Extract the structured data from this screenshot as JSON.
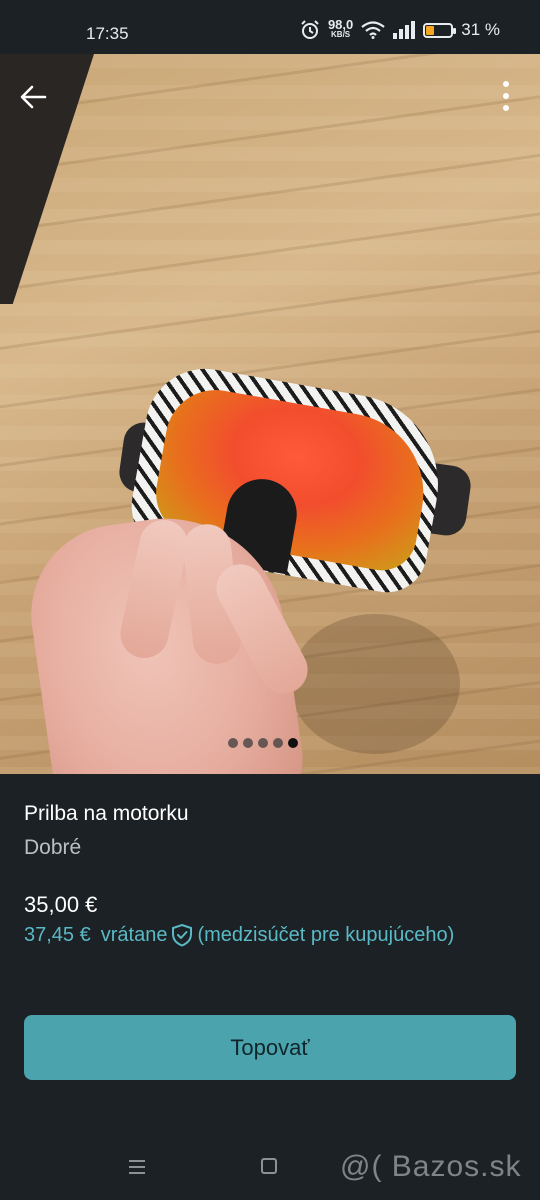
{
  "status_bar": {
    "time": "17:35",
    "net_speed_value": "98,0",
    "net_speed_unit": "KB/S",
    "battery_percent": "31 %",
    "battery_level": 0.31,
    "icons": [
      "alarm-icon",
      "wifi-icon",
      "signal-icon",
      "battery-icon"
    ]
  },
  "photo": {
    "slide_count": 5,
    "active_index": 4,
    "icons": [
      "back-arrow-icon",
      "more-vertical-icon"
    ]
  },
  "listing": {
    "title": "Prilba na motorku",
    "condition": "Dobré",
    "price": "35,00 €",
    "buyer_price": "37,45 €",
    "incl_label": "vrátane",
    "incl_note": "(medzisúčet pre kupujúceho)",
    "accent_color": "#5bb9c6"
  },
  "actions": {
    "topovat_label": "Topovať",
    "button_color": "#4aa3ad"
  },
  "watermark": {
    "text": "@( Bazos.sk"
  }
}
